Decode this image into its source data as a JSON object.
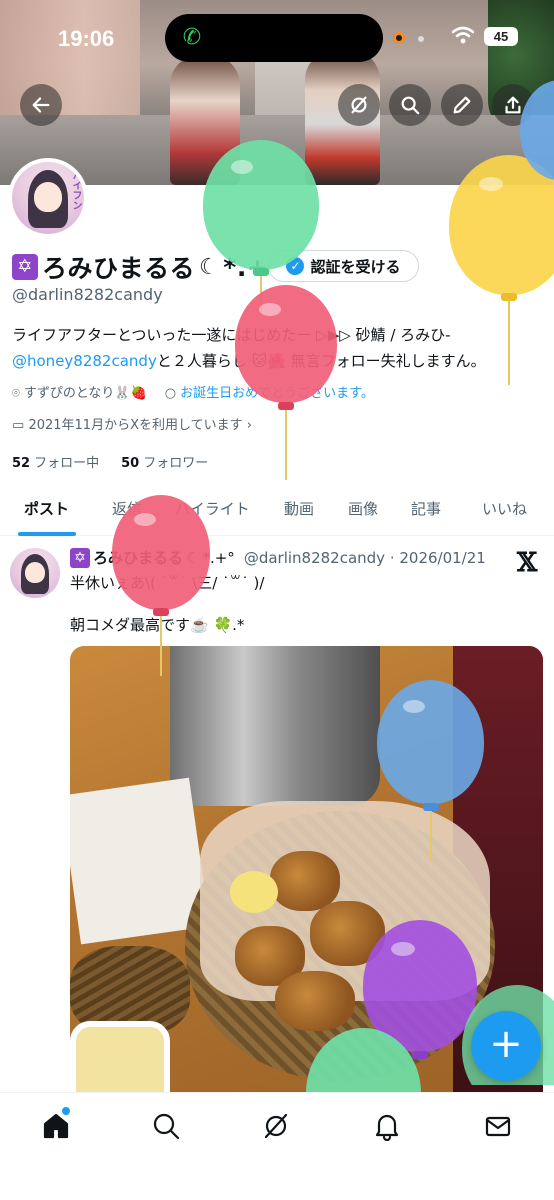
{
  "status_bar": {
    "time": "19:06",
    "battery": "45"
  },
  "profile": {
    "name": "ろみひまるる",
    "name_suffix": "*.+",
    "name_star": "✡",
    "verify_label": "認証を受ける",
    "handle": "@darlin8282candy",
    "bio_line1": "ライフアフターとついった一遂にはじめたー ▷▶︎▷ 砂鯖 / ろみひ-",
    "bio_link": "@honey8282candy",
    "bio_line2_rest": "と２人暮らし 🐱🌺 無言フォロー失礼しますん。",
    "location": "すずぴのとなり🐰🍓",
    "birthday": "お誕生日おめでとうございます。",
    "joined": "2021年11月からXを利用しています",
    "following_count": "52",
    "following_label": "フォロー中",
    "followers_count": "50",
    "followers_label": "フォロワー",
    "avatar_text": "ハイフン"
  },
  "tabs": [
    {
      "label": "ポスト"
    },
    {
      "label": "返信"
    },
    {
      "label": "ハイライト"
    },
    {
      "label": "動画"
    },
    {
      "label": "画像"
    },
    {
      "label": "記事"
    },
    {
      "label": "いいね"
    }
  ],
  "post": {
    "name": "ろみひまるる",
    "name_suffix": "*.+°",
    "star": "✡",
    "handle_date": "@darlin8282candy · 2026/01/21",
    "text_line1": "半休いぇあ\\( ˙꒳˙ \\三/ ˙꒳˙ )/",
    "text_line2": "朝コメダ最高です☕️ 🍀.*"
  },
  "fab_label": "+",
  "icons": {
    "back": "back-arrow-icon",
    "grok": "grok-icon",
    "search": "search-icon",
    "edit": "pencil-icon",
    "share": "share-icon",
    "nav": [
      "home-icon",
      "search-icon",
      "grok-icon",
      "bell-icon",
      "mail-icon"
    ]
  },
  "colors": {
    "accent": "#1d9bf0",
    "text": "#0f1419",
    "muted": "#536471"
  },
  "balloons": [
    "green",
    "yellow",
    "pink",
    "blue",
    "purple"
  ]
}
